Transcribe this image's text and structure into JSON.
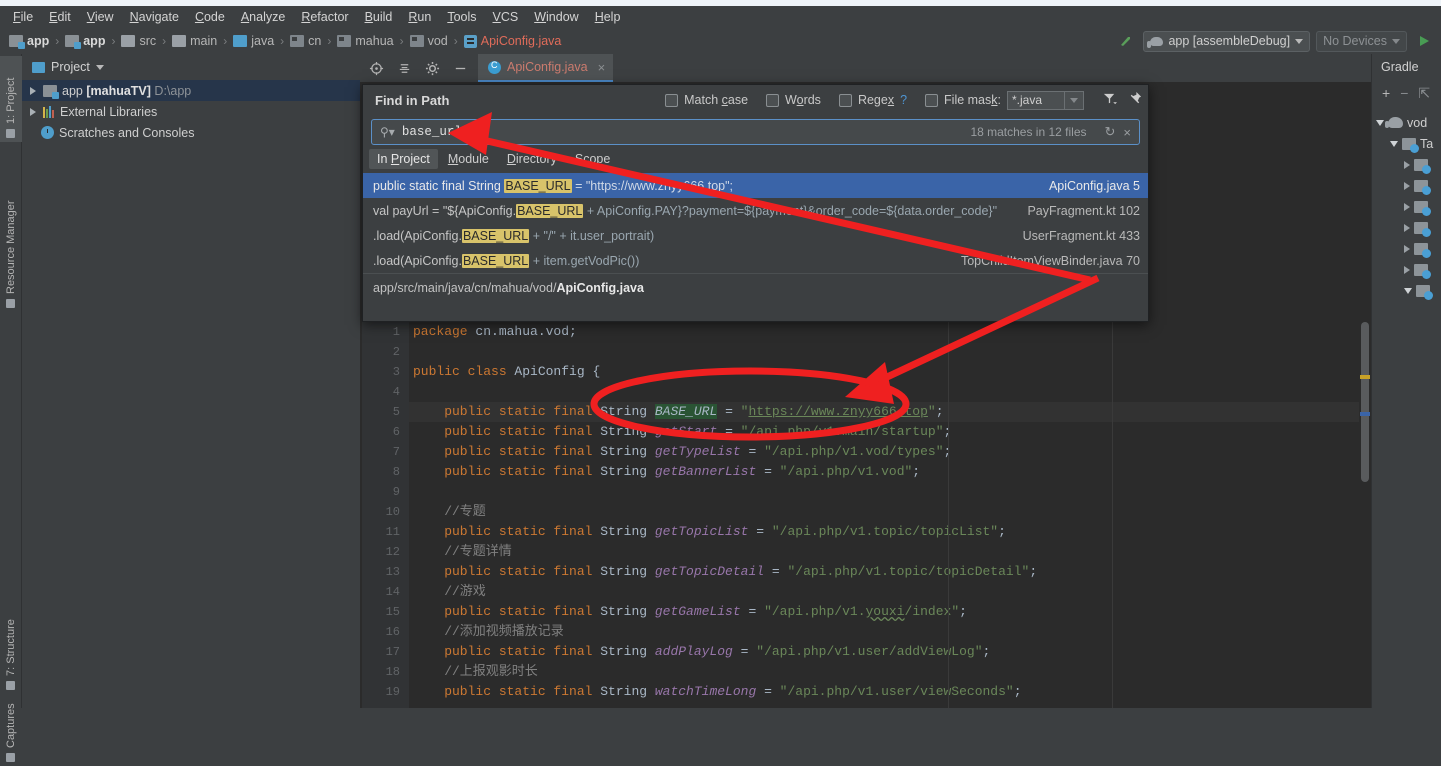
{
  "menu": {
    "items": [
      "File",
      "Edit",
      "View",
      "Navigate",
      "Code",
      "Analyze",
      "Refactor",
      "Build",
      "Run",
      "Tools",
      "VCS",
      "Window",
      "Help"
    ]
  },
  "breadcrumb": {
    "items": [
      {
        "label": "app",
        "icon": "module-icon",
        "bold": true
      },
      {
        "label": "app",
        "icon": "module-icon",
        "bold": true
      },
      {
        "label": "src",
        "icon": "folder-icon",
        "bold": false
      },
      {
        "label": "main",
        "icon": "folder-icon",
        "bold": false
      },
      {
        "label": "java",
        "icon": "source-folder-icon",
        "bold": false
      },
      {
        "label": "cn",
        "icon": "package-icon",
        "bold": false
      },
      {
        "label": "mahua",
        "icon": "package-icon",
        "bold": false
      },
      {
        "label": "vod",
        "icon": "package-icon",
        "bold": false
      },
      {
        "label": "ApiConfig.java",
        "icon": "java-class-icon",
        "bold": false,
        "file": true
      }
    ],
    "separator": "›"
  },
  "toolbar": {
    "run_config": "app [assembleDebug]",
    "device": "No Devices",
    "run_icon": "run-play-icon",
    "build_icon": "make-project-icon"
  },
  "left_strip": {
    "items": [
      {
        "label": "1: Project",
        "selected": true
      },
      {
        "label": "Resource Manager",
        "selected": false
      },
      {
        "label": "7: Structure",
        "selected": false
      },
      {
        "label": "Captures",
        "selected": false
      }
    ]
  },
  "project_panel": {
    "title": "Project",
    "tree": [
      {
        "label": "app",
        "module": "[mahuaTV]",
        "path": "D:\\app",
        "selected": true,
        "expandable": true,
        "icon": "module-icon"
      },
      {
        "label": "External Libraries",
        "selected": false,
        "expandable": true,
        "icon": "libraries-icon"
      },
      {
        "label": "Scratches and Consoles",
        "selected": false,
        "expandable": false,
        "icon": "scratches-icon"
      }
    ]
  },
  "editor_tab": {
    "label": "ApiConfig.java",
    "close": "×",
    "toolbar_icons": [
      "locate-icon",
      "collapse-all-icon",
      "settings-gear-icon",
      "hide-icon"
    ]
  },
  "find_in_path": {
    "title": "Find in Path",
    "options": [
      {
        "label": "Match case",
        "checked": false,
        "mnemonic": "c"
      },
      {
        "label": "Words",
        "checked": false,
        "mnemonic": "o"
      },
      {
        "label": "Regex",
        "checked": false,
        "mnemonic": "x",
        "help": "?"
      },
      {
        "label": "File mask:",
        "checked": false,
        "mnemonic": "k"
      }
    ],
    "file_mask_value": "*.java",
    "filter_icon": "filter-icon",
    "pin_icon": "pin-icon",
    "search_value": "base_url",
    "search_icon": "search-icon",
    "match_info": "18 matches in 12 files",
    "refresh_icon": "↻",
    "clear_icon": "×",
    "scope_tabs": [
      {
        "label": "In Project",
        "active": true
      },
      {
        "label": "Module",
        "active": false
      },
      {
        "label": "Directory",
        "active": false
      },
      {
        "label": "Scope",
        "active": false
      }
    ],
    "results": [
      {
        "selected": true,
        "prefix": "public static final String ",
        "match": "BASE_URL",
        "suffix": " = \"https://www.znyy666.top\";",
        "location": "ApiConfig.java 5"
      },
      {
        "selected": false,
        "prefix": "val payUrl = \"${ApiConfig.",
        "match": "BASE_URL",
        "suffix": " + ApiConfig.PAY}?payment=${payment}&order_code=${data.order_code}\"",
        "location": "PayFragment.kt 102"
      },
      {
        "selected": false,
        "prefix": ".load(ApiConfig.",
        "match": "BASE_URL",
        "suffix": " + \"/\" + it.user_portrait)",
        "location": "UserFragment.kt 433"
      },
      {
        "selected": false,
        "prefix": ".load(ApiConfig.",
        "match": "BASE_URL",
        "suffix": " + item.getVodPic())",
        "location": "TopChildItemViewBinder.java 70"
      }
    ],
    "result_path_prefix": "app/src/main/java/cn/mahua/vod/",
    "result_path_file": "ApiConfig.java"
  },
  "editor": {
    "first_line": 1,
    "current_line": 5,
    "lines": [
      {
        "n": 1,
        "tokens": [
          {
            "t": "package ",
            "c": "c-kw"
          },
          {
            "t": "cn.mahua.vod;",
            "c": "c-punc"
          }
        ]
      },
      {
        "n": 2,
        "tokens": []
      },
      {
        "n": 3,
        "tokens": [
          {
            "t": "public class ",
            "c": "c-kw"
          },
          {
            "t": "ApiConfig",
            "c": "c-type"
          },
          {
            "t": " {",
            "c": "c-punc"
          }
        ]
      },
      {
        "n": 4,
        "tokens": []
      },
      {
        "n": 5,
        "current": true,
        "tokens": [
          {
            "t": "    public static final ",
            "c": "c-kw"
          },
          {
            "t": "String ",
            "c": "c-type"
          },
          {
            "t": "BASE_URL",
            "c": "c-field-hl"
          },
          {
            "t": " = ",
            "c": "c-punc"
          },
          {
            "t": "\"",
            "c": "c-str"
          },
          {
            "t": "https://www.znyy666.top",
            "c": "c-link"
          },
          {
            "t": "\"",
            "c": "c-str"
          },
          {
            "t": ";",
            "c": "c-punc"
          }
        ]
      },
      {
        "n": 6,
        "tokens": [
          {
            "t": "    public static final ",
            "c": "c-kw"
          },
          {
            "t": "String ",
            "c": "c-type"
          },
          {
            "t": "getStart",
            "c": "c-field"
          },
          {
            "t": " = ",
            "c": "c-punc"
          },
          {
            "t": "\"/api.php/v1.main/startup\"",
            "c": "c-str"
          },
          {
            "t": ";",
            "c": "c-punc"
          }
        ]
      },
      {
        "n": 7,
        "tokens": [
          {
            "t": "    public static final ",
            "c": "c-kw"
          },
          {
            "t": "String ",
            "c": "c-type"
          },
          {
            "t": "getTypeList",
            "c": "c-field"
          },
          {
            "t": " = ",
            "c": "c-punc"
          },
          {
            "t": "\"/api.php/v1.vod/types\"",
            "c": "c-str"
          },
          {
            "t": ";",
            "c": "c-punc"
          }
        ]
      },
      {
        "n": 8,
        "tokens": [
          {
            "t": "    public static final ",
            "c": "c-kw"
          },
          {
            "t": "String ",
            "c": "c-type"
          },
          {
            "t": "getBannerList",
            "c": "c-field"
          },
          {
            "t": " = ",
            "c": "c-punc"
          },
          {
            "t": "\"/api.php/v1.vod\"",
            "c": "c-str"
          },
          {
            "t": ";",
            "c": "c-punc"
          }
        ]
      },
      {
        "n": 9,
        "tokens": []
      },
      {
        "n": 10,
        "tokens": [
          {
            "t": "    //专题",
            "c": "c-cmt"
          }
        ]
      },
      {
        "n": 11,
        "tokens": [
          {
            "t": "    public static final ",
            "c": "c-kw"
          },
          {
            "t": "String ",
            "c": "c-type"
          },
          {
            "t": "getTopicList",
            "c": "c-field"
          },
          {
            "t": " = ",
            "c": "c-punc"
          },
          {
            "t": "\"/api.php/v1.topic/topicList\"",
            "c": "c-str"
          },
          {
            "t": ";",
            "c": "c-punc"
          }
        ]
      },
      {
        "n": 12,
        "tokens": [
          {
            "t": "    //专题详情",
            "c": "c-cmt"
          }
        ]
      },
      {
        "n": 13,
        "tokens": [
          {
            "t": "    public static final ",
            "c": "c-kw"
          },
          {
            "t": "String ",
            "c": "c-type"
          },
          {
            "t": "getTopicDetail",
            "c": "c-field"
          },
          {
            "t": " = ",
            "c": "c-punc"
          },
          {
            "t": "\"/api.php/v1.topic/topicDetail\"",
            "c": "c-str"
          },
          {
            "t": ";",
            "c": "c-punc"
          }
        ]
      },
      {
        "n": 14,
        "tokens": [
          {
            "t": "    //游戏",
            "c": "c-cmt"
          }
        ]
      },
      {
        "n": 15,
        "tokens": [
          {
            "t": "    public static final ",
            "c": "c-kw"
          },
          {
            "t": "String ",
            "c": "c-type"
          },
          {
            "t": "getGameList",
            "c": "c-field"
          },
          {
            "t": " = ",
            "c": "c-punc"
          },
          {
            "t": "\"/api.php/v1.",
            "c": "c-str"
          },
          {
            "t": "youxi",
            "c": "c-squig c-str"
          },
          {
            "t": "/index\"",
            "c": "c-str"
          },
          {
            "t": ";",
            "c": "c-punc"
          }
        ]
      },
      {
        "n": 16,
        "tokens": [
          {
            "t": "    //添加视频播放记录",
            "c": "c-cmt"
          }
        ]
      },
      {
        "n": 17,
        "tokens": [
          {
            "t": "    public static final ",
            "c": "c-kw"
          },
          {
            "t": "String ",
            "c": "c-type"
          },
          {
            "t": "addPlayLog",
            "c": "c-field"
          },
          {
            "t": " = ",
            "c": "c-punc"
          },
          {
            "t": "\"/api.php/v1.user/addViewLog\"",
            "c": "c-str"
          },
          {
            "t": ";",
            "c": "c-punc"
          }
        ]
      },
      {
        "n": 18,
        "tokens": [
          {
            "t": "    //上报观影时长",
            "c": "c-cmt"
          }
        ]
      },
      {
        "n": 19,
        "tokens": [
          {
            "t": "    public static final ",
            "c": "c-kw"
          },
          {
            "t": "String ",
            "c": "c-type"
          },
          {
            "t": "watchTimeLong",
            "c": "c-field"
          },
          {
            "t": " = ",
            "c": "c-punc"
          },
          {
            "t": "\"/api.php/v1.user/viewSeconds\"",
            "c": "c-str"
          },
          {
            "t": ";",
            "c": "c-punc"
          }
        ]
      }
    ]
  },
  "gradle_panel": {
    "title": "Gradle",
    "toolbar": [
      "add-icon",
      "remove-icon",
      "attach-icon"
    ],
    "tree": [
      {
        "label": "vod",
        "depth": 0,
        "state": "down",
        "icon": "gradle-elephant-icon"
      },
      {
        "label": "Ta",
        "depth": 1,
        "state": "down",
        "icon": "tasks-folder-icon"
      },
      {
        "label": "",
        "depth": 2,
        "state": "right",
        "icon": "tasks-folder-icon"
      },
      {
        "label": "",
        "depth": 2,
        "state": "right",
        "icon": "tasks-folder-icon"
      },
      {
        "label": "",
        "depth": 2,
        "state": "right",
        "icon": "tasks-folder-icon"
      },
      {
        "label": "",
        "depth": 2,
        "state": "right",
        "icon": "tasks-folder-icon"
      },
      {
        "label": "",
        "depth": 2,
        "state": "right",
        "icon": "tasks-folder-icon"
      },
      {
        "label": "",
        "depth": 2,
        "state": "right",
        "icon": "tasks-folder-icon"
      },
      {
        "label": "",
        "depth": 2,
        "state": "down",
        "icon": "tasks-folder-icon"
      }
    ]
  },
  "annotations": {
    "arrow_to_search": "red-arrow",
    "arrow_to_code": "red-arrow",
    "ellipse_on_base_url": "red-ellipse",
    "color": "#ef2020"
  },
  "colors": {
    "accent_blue": "#3a64a8",
    "highlight_yellow": "#d8c36a",
    "editor_bg": "#2b2b2b",
    "panel_bg": "#3c3f41",
    "annotation_red": "#ef2020",
    "tab_underline": "#4a88c7"
  }
}
